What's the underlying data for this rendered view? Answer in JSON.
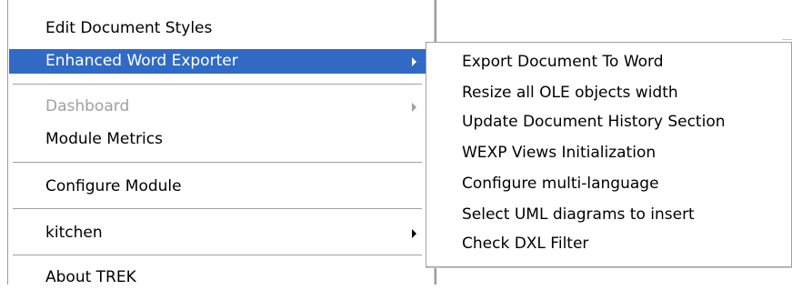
{
  "main_menu": {
    "items": [
      {
        "label": "Edit Document Styles",
        "has_submenu": false,
        "state": "normal"
      },
      {
        "label": "Enhanced Word Exporter",
        "has_submenu": true,
        "state": "highlighted"
      },
      {
        "label": "Dashboard",
        "has_submenu": true,
        "state": "disabled"
      },
      {
        "label": "Module Metrics",
        "has_submenu": false,
        "state": "normal"
      },
      {
        "label": "Configure Module",
        "has_submenu": false,
        "state": "normal"
      },
      {
        "label": "kitchen",
        "has_submenu": true,
        "state": "normal"
      },
      {
        "label": "About TREK",
        "has_submenu": false,
        "state": "normal"
      }
    ]
  },
  "submenu": {
    "items": [
      {
        "label": "Export Document To Word"
      },
      {
        "label": "Resize all OLE objects width"
      },
      {
        "label": "Update Document History Section"
      },
      {
        "label": "WEXP Views Initialization"
      },
      {
        "label": "Configure multi-language"
      },
      {
        "label": "Select UML diagrams to insert"
      },
      {
        "label": "Check DXL Filter"
      }
    ]
  },
  "colors": {
    "highlight": "#316ac5",
    "disabled_text": "#a0a0a0",
    "menu_background": "#ffffff"
  }
}
